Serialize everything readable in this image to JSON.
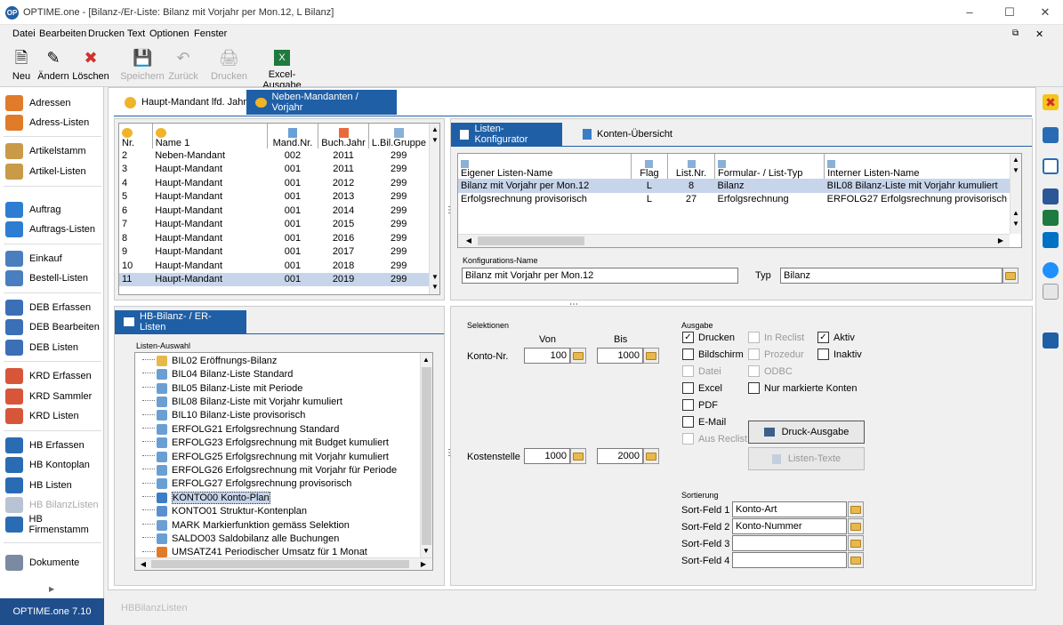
{
  "window": {
    "title": "OPTIME.one  - [Bilanz-/Er-Liste: Bilanz mit Vorjahr per Mon.12, L Bilanz]",
    "app_icon": "OP"
  },
  "menu": [
    "Datei",
    "Bearbeiten",
    "Drucken",
    "Text",
    "Optionen",
    "Fenster"
  ],
  "toolbar": {
    "neu": "Neu",
    "aendern": "Ändern",
    "loeschen": "Löschen",
    "speichern": "Speichern",
    "zurueck": "Zurück",
    "drucken": "Drucken",
    "excel": "Excel-Ausgabe"
  },
  "sidebar": [
    {
      "label": "Adressen",
      "icon": "address-icon",
      "color": "#e07b2a"
    },
    {
      "label": "Adress-Listen",
      "icon": "address-list-icon",
      "color": "#e07b2a"
    },
    {
      "label": "Artikelstamm",
      "icon": "article-icon",
      "color": "#c99a48"
    },
    {
      "label": "Artikel-Listen",
      "icon": "article-list-icon",
      "color": "#c99a48"
    },
    {
      "label": "Auftrag",
      "icon": "order-icon",
      "color": "#2d7dd2"
    },
    {
      "label": "Auftrags-Listen",
      "icon": "order-list-icon",
      "color": "#2d7dd2"
    },
    {
      "label": "Einkauf",
      "icon": "cart-icon",
      "color": "#4a7fbf"
    },
    {
      "label": "Bestell-Listen",
      "icon": "purchase-list-icon",
      "color": "#4a7fbf"
    },
    {
      "label": "DEB Erfassen",
      "icon": "debitor-entry-icon",
      "color": "#3b6fb6"
    },
    {
      "label": "DEB Bearbeiten",
      "icon": "debitor-edit-icon",
      "color": "#3b6fb6"
    },
    {
      "label": "DEB Listen",
      "icon": "debitor-list-icon",
      "color": "#3b6fb6"
    },
    {
      "label": "KRD Erfassen",
      "icon": "creditor-entry-icon",
      "color": "#d7563a"
    },
    {
      "label": "KRD Sammler",
      "icon": "creditor-collect-icon",
      "color": "#d7563a"
    },
    {
      "label": "KRD Listen",
      "icon": "creditor-list-icon",
      "color": "#d7563a"
    },
    {
      "label": "HB Erfassen",
      "icon": "ledger-entry-icon",
      "color": "#2a6cb3"
    },
    {
      "label": "HB Kontoplan",
      "icon": "chart-of-accounts-icon",
      "color": "#2a6cb3"
    },
    {
      "label": "HB Listen",
      "icon": "ledger-list-icon",
      "color": "#2a6cb3"
    },
    {
      "label": "HB BilanzListen",
      "icon": "balance-list-icon",
      "color": "#b8c4d4",
      "disabled": true
    },
    {
      "label": "HB Firmenstamm",
      "icon": "company-icon",
      "color": "#2a6cb3"
    },
    {
      "label": "Dokumente",
      "icon": "documents-icon",
      "color": "#7a8aa0"
    }
  ],
  "status": "OPTIME.one  7.10",
  "bottom_ghost": "HBBilanzListen",
  "tabs": {
    "tab1": "Haupt-Mandant lfd. Jahr",
    "tab2": "Neben-Mandanten / Vorjahr"
  },
  "mandant_table": {
    "headers": [
      "Nr.",
      "Name 1",
      "Mand.Nr.",
      "Buch.Jahr",
      "L.Bil.Gruppe"
    ],
    "rows": [
      [
        "2",
        "Neben-Mandant",
        "002",
        "2011",
        "299"
      ],
      [
        "3",
        "Haupt-Mandant",
        "001",
        "2011",
        "299"
      ],
      [
        "4",
        "Haupt-Mandant",
        "001",
        "2012",
        "299"
      ],
      [
        "5",
        "Haupt-Mandant",
        "001",
        "2013",
        "299"
      ],
      [
        "6",
        "Haupt-Mandant",
        "001",
        "2014",
        "299"
      ],
      [
        "7",
        "Haupt-Mandant",
        "001",
        "2015",
        "299"
      ],
      [
        "8",
        "Haupt-Mandant",
        "001",
        "2016",
        "299"
      ],
      [
        "9",
        "Haupt-Mandant",
        "001",
        "2017",
        "299"
      ],
      [
        "10",
        "Haupt-Mandant",
        "001",
        "2018",
        "299"
      ],
      [
        "11",
        "Haupt-Mandant",
        "001",
        "2019",
        "299"
      ]
    ],
    "selected": 9
  },
  "config_tabs": {
    "tab1": "Listen-Konfigurator",
    "tab2": "Konten-Übersicht"
  },
  "config_table": {
    "headers": [
      "Eigener Listen-Name",
      "Flag",
      "List.Nr.",
      "Formular- / List-Typ",
      "Interner Listen-Name"
    ],
    "rows": [
      [
        "Bilanz mit Vorjahr per Mon.12",
        "L",
        "8",
        "Bilanz",
        "BIL08  Bilanz-Liste mit Vorjahr kumuliert"
      ],
      [
        "Erfolgsrechnung provisorisch",
        "L",
        "27",
        "Erfolgsrechnung",
        "ERFOLG27  Erfolgsrechnung provisorisch"
      ]
    ],
    "selected": 0
  },
  "konfig": {
    "name_label": "Konfigurations-Name",
    "name_value": "Bilanz mit Vorjahr per Mon.12",
    "typ_label": "Typ",
    "typ_value": "Bilanz"
  },
  "hb_tab": "HB-Bilanz- / ER-Listen",
  "listen_auswahl": {
    "label": "Listen-Auswahl",
    "items": [
      "BIL02  Eröffnungs-Bilanz",
      "BIL04  Bilanz-Liste Standard",
      "BIL05  Bilanz-Liste mit Periode",
      "BIL08  Bilanz-Liste mit Vorjahr kumuliert",
      "BIL10  Bilanz-Liste provisorisch",
      "ERFOLG21  Erfolgsrechnung Standard",
      "ERFOLG23  Erfolgsrechnung mit Budget kumuliert",
      "ERFOLG25  Erfolgsrechnung mit Vorjahr kumuliert",
      "ERFOLG26  Erfolgsrechnung mit Vorjahr für Periode",
      "ERFOLG27  Erfolgsrechnung provisorisch",
      "KONTO00  Konto-Plan",
      "KONTO01  Struktur-Kontenplan",
      "MARK  Markierfunktion gemäss Selektion",
      "SALDO03  Saldobilanz alle Buchungen",
      "UMSATZ41  Periodischer Umsatz für 1 Monat"
    ],
    "selected": 10
  },
  "selektionen": {
    "label": "Selektionen",
    "von": "Von",
    "bis": "Bis",
    "konto_label": "Konto-Nr.",
    "konto_von": "100",
    "konto_bis": "1000",
    "kst_label": "Kostenstelle",
    "kst_von": "1000",
    "kst_bis": "2000"
  },
  "ausgabe": {
    "label": "Ausgabe",
    "drucken": "Drucken",
    "bildschirm": "Bildschirm",
    "datei": "Datei",
    "excel": "Excel",
    "pdf": "PDF",
    "email": "E-Mail",
    "aus_reclist": "Aus Reclist",
    "in_reclist": "In Reclist",
    "prozedur": "Prozedur",
    "odbc": "ODBC",
    "nur_markierte": "Nur markierte Konten",
    "aktiv": "Aktiv",
    "inaktiv": "Inaktiv",
    "checked": {
      "drucken": "✓",
      "aktiv": "✓"
    }
  },
  "buttons": {
    "druck_ausgabe": "Druck-Ausgabe",
    "listen_texte": "Listen-Texte"
  },
  "sortierung": {
    "label": "Sortierung",
    "fields": [
      {
        "label": "Sort-Feld 1",
        "value": "Konto-Art"
      },
      {
        "label": "Sort-Feld 2",
        "value": "Konto-Nummer"
      },
      {
        "label": "Sort-Feld 3",
        "value": ""
      },
      {
        "label": "Sort-Feld 4",
        "value": ""
      }
    ]
  }
}
